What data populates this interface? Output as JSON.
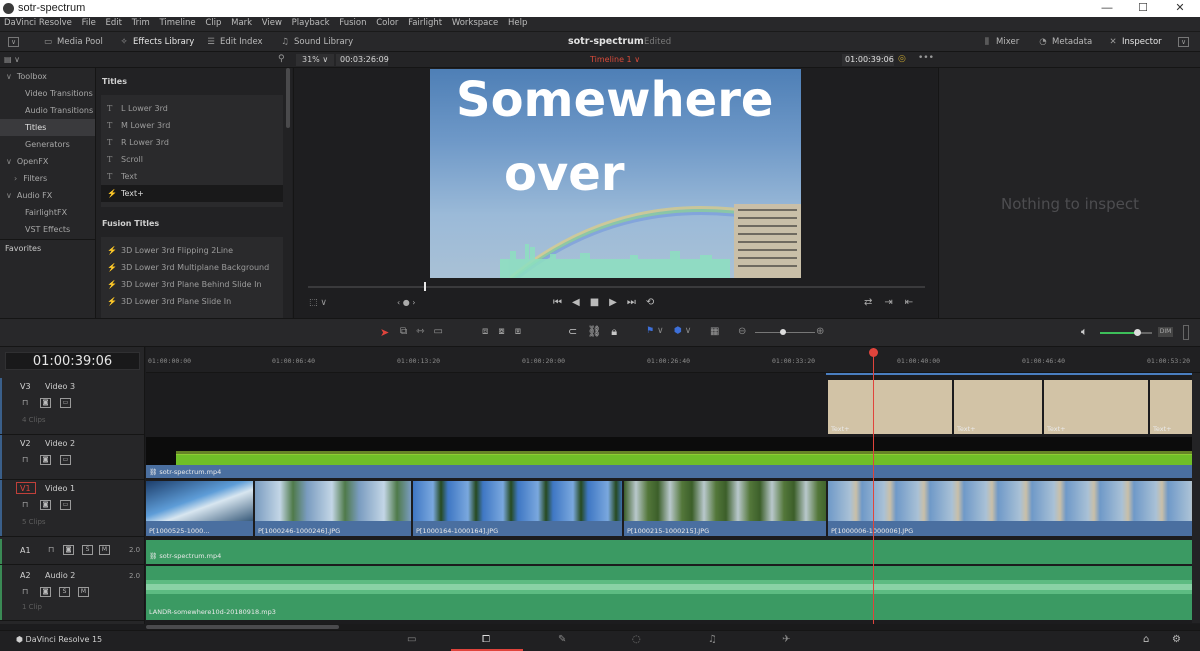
{
  "window": {
    "title": "sotr-spectrum",
    "minimize": "—",
    "maximize": "☐",
    "close": "✕"
  },
  "menu": [
    "DaVinci Resolve",
    "File",
    "Edit",
    "Trim",
    "Timeline",
    "Clip",
    "Mark",
    "View",
    "Playback",
    "Fusion",
    "Color",
    "Fairlight",
    "Workspace",
    "Help"
  ],
  "toolbar": {
    "media_pool": "Media Pool",
    "effects_library": "Effects Library",
    "edit_index": "Edit Index",
    "sound_library": "Sound Library",
    "project_name": "sotr-spectrum",
    "project_status": "Edited",
    "mixer": "Mixer",
    "metadata": "Metadata",
    "inspector": "Inspector"
  },
  "viewer": {
    "zoom": "31%",
    "duration": "00:03:26:09",
    "timeline_name": "Timeline 1",
    "timecode": "01:00:39:06",
    "overlay_line1": "Somewhere",
    "overlay_line2": "over"
  },
  "inspector": {
    "empty_message": "Nothing to inspect"
  },
  "toolbox": {
    "items": [
      {
        "label": "Toolbox",
        "level": 0,
        "arrow": "∨"
      },
      {
        "label": "Video Transitions",
        "level": 1
      },
      {
        "label": "Audio Transitions",
        "level": 1
      },
      {
        "label": "Titles",
        "level": 1,
        "selected": true
      },
      {
        "label": "Generators",
        "level": 1
      },
      {
        "label": "OpenFX",
        "level": 0,
        "arrow": "∨"
      },
      {
        "label": "Filters",
        "level": 1,
        "arrow": "›"
      },
      {
        "label": "Audio FX",
        "level": 0,
        "arrow": "∨"
      },
      {
        "label": "FairlightFX",
        "level": 1
      },
      {
        "label": "VST Effects",
        "level": 1
      }
    ],
    "favorites": "Favorites"
  },
  "titles": {
    "heading": "Titles",
    "items": [
      "L Lower 3rd",
      "M Lower 3rd",
      "R Lower 3rd",
      "Scroll",
      "Text",
      "Text+"
    ],
    "selected": "Text+"
  },
  "fusion_titles": {
    "heading": "Fusion Titles",
    "items": [
      "3D Lower 3rd Flipping 2Line",
      "3D Lower 3rd Multiplane Background",
      "3D Lower 3rd Plane Behind Slide In",
      "3D Lower 3rd Plane Slide In"
    ]
  },
  "timeline": {
    "timecode": "01:00:39:06",
    "ruler": [
      "01:00:00:00",
      "01:00:06:40",
      "01:00:13:20",
      "01:00:20:00",
      "01:00:26:40",
      "01:00:33:20",
      "01:00:40:00",
      "01:00:46:40",
      "01:00:53:20"
    ],
    "playhead_fraction": 0.695,
    "tracks": [
      {
        "id": "V3",
        "name": "Video 3",
        "clips": "4 Clips"
      },
      {
        "id": "V2",
        "name": "Video 2",
        "clips": ""
      },
      {
        "id": "V1",
        "name": "Video 1",
        "clips": "5 Clips"
      },
      {
        "id": "A1",
        "name": "",
        "level": "2.0",
        "clips": ""
      },
      {
        "id": "A2",
        "name": "Audio 2",
        "level": "2.0",
        "clips": "1 Clip"
      }
    ],
    "v3_clips": [
      "Text+",
      "Text+",
      "Text+",
      "Text+"
    ],
    "v2_clip": "sotr-spectrum.mp4",
    "v1_clips": [
      "P[1000525-1000...",
      "P[1000246-1000246].JPG",
      "P[1000164-1000164].JPG",
      "P[1000215-1000215].JPG",
      "P[1000006-1000006].JPG"
    ],
    "a1_clip": "sotr-spectrum.mp4",
    "a2_clip": "LANDR-somewhere10d-20180918.mp3",
    "track_buttons": {
      "s": "S",
      "m": "M"
    }
  },
  "statusbar": {
    "app": "DaVinci Resolve 15"
  },
  "colors": {
    "accent_red": "#e0443c",
    "clip_blue": "#4a6fa0",
    "audio_green": "#3b9a63",
    "title_clip": "#d2c3a6"
  }
}
